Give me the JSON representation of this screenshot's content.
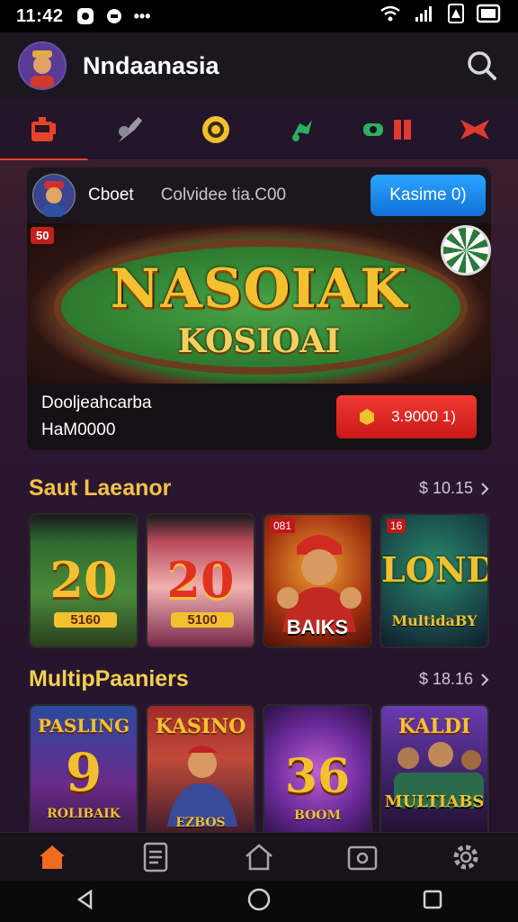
{
  "status_bar": {
    "time": "11:42",
    "icons": [
      "notification-icon",
      "circle-icon",
      "more-icon",
      "wifi-icon",
      "signal-icon",
      "battery-icon"
    ],
    "dots": "•••"
  },
  "header": {
    "title": "Nndaanasia",
    "icons": {
      "avatar": "user-avatar",
      "search": "search-icon"
    }
  },
  "categories": [
    {
      "name": "slots",
      "icon": "slot-machine-icon",
      "color": "#e5442b",
      "active": true
    },
    {
      "name": "table",
      "icon": "club-icon",
      "color": "#9a9aa6",
      "active": false
    },
    {
      "name": "coin",
      "icon": "coin-icon",
      "color": "#f0c030",
      "active": false
    },
    {
      "name": "live",
      "icon": "live-icon",
      "color": "#2ab060",
      "active": false
    },
    {
      "name": "cards",
      "icon": "cards-icon",
      "color": "#e03a30",
      "active": false
    },
    {
      "name": "bonus",
      "icon": "bonus-icon",
      "color": "#e03a30",
      "active": false
    }
  ],
  "feature": {
    "user_name": "Cboet",
    "status": "Colvidee tia.C00",
    "join_button": "Kasime 0)",
    "badge": "50",
    "logo": "NASOIAK",
    "logo_sub": "KOSIOAI",
    "line1": "Dooljeahcarba",
    "line2": "HaM0000",
    "play_button": "3.9000 1)"
  },
  "section1": {
    "title": "Saut Laeanor",
    "see_all": "$ 10.15"
  },
  "tiles1": [
    {
      "label": "20",
      "sub": "5160",
      "badge": "",
      "bg": "green-slot"
    },
    {
      "label": "20",
      "sub": "5100",
      "badge": "",
      "bg": "pink-slot"
    },
    {
      "label": "BAIKS",
      "sub": "",
      "badge": "081",
      "bg": "red-character"
    },
    {
      "label": "LOND",
      "sub": "MultidaBY",
      "badge": "16",
      "bg": "green-lucky"
    }
  ],
  "section2": {
    "title": "MultipPaaniers",
    "see_all": "$ 18.16"
  },
  "tiles2": [
    {
      "label": "PASLING",
      "big": "9",
      "sub": "ROLIBAIK",
      "bg": "blue"
    },
    {
      "label": "KASINO",
      "big": "",
      "sub": "EZBOS",
      "bg": "red"
    },
    {
      "label": "36",
      "big": "36",
      "sub": "BOOM",
      "bg": "purple"
    },
    {
      "label": "KALDI",
      "big": "",
      "sub": "MULTIABS",
      "bg": "violet"
    }
  ],
  "bottom_nav": [
    {
      "name": "home",
      "icon": "home-icon",
      "active": true
    },
    {
      "name": "list",
      "icon": "document-icon",
      "active": false
    },
    {
      "name": "house",
      "icon": "house-outline-icon",
      "active": false
    },
    {
      "name": "wallet",
      "icon": "wallet-icon",
      "active": false
    },
    {
      "name": "settings",
      "icon": "settings-icon",
      "active": false
    }
  ],
  "colors": {
    "accent": "#e5442b",
    "blue_button": "#1e8ff0",
    "gold": "#f2c24a",
    "red_button": "#e0302a"
  }
}
